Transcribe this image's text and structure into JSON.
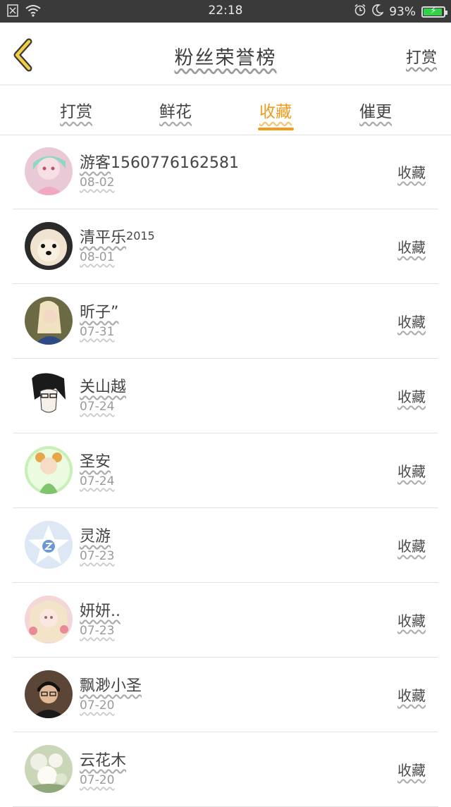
{
  "status_bar": {
    "time": "22:18",
    "battery_percent_label": "93%",
    "battery_level": 0.93,
    "icons": [
      "notification-x-icon",
      "wifi-icon",
      "alarm-icon",
      "moon-icon",
      "battery-charging-icon"
    ]
  },
  "header": {
    "title": "粉丝荣誉榜",
    "action_label": "打赏",
    "back_icon": "chevron-left-icon"
  },
  "tabs": [
    {
      "label": "打赏",
      "active": false
    },
    {
      "label": "鲜花",
      "active": false
    },
    {
      "label": "收藏",
      "active": true
    },
    {
      "label": "催更",
      "active": false
    }
  ],
  "colors": {
    "accent": "#f09b1b",
    "status_bar": "#3a3a3a",
    "battery": "#35d04a"
  },
  "fans": [
    {
      "name_cn": "游客",
      "name_latin": "1560776162581",
      "date": "08-02",
      "action": "收藏"
    },
    {
      "name_cn": "清平乐",
      "name_latin": "2015",
      "date": "08-01",
      "action": "收藏"
    },
    {
      "name_cn": "昕子”",
      "name_latin": "",
      "date": "07-31",
      "action": "收藏"
    },
    {
      "name_cn": "关山越",
      "name_latin": "",
      "date": "07-24",
      "action": "收藏"
    },
    {
      "name_cn": "圣安",
      "name_latin": "",
      "date": "07-24",
      "action": "收藏"
    },
    {
      "name_cn": "灵游",
      "name_latin": "",
      "date": "07-23",
      "action": "收藏"
    },
    {
      "name_cn": "妍妍..",
      "name_latin": "",
      "date": "07-23",
      "action": "收藏"
    },
    {
      "name_cn": "飘渺小圣",
      "name_latin": "",
      "date": "07-20",
      "action": "收藏"
    },
    {
      "name_cn": "云花木",
      "name_latin": "",
      "date": "07-20",
      "action": "收藏"
    }
  ]
}
